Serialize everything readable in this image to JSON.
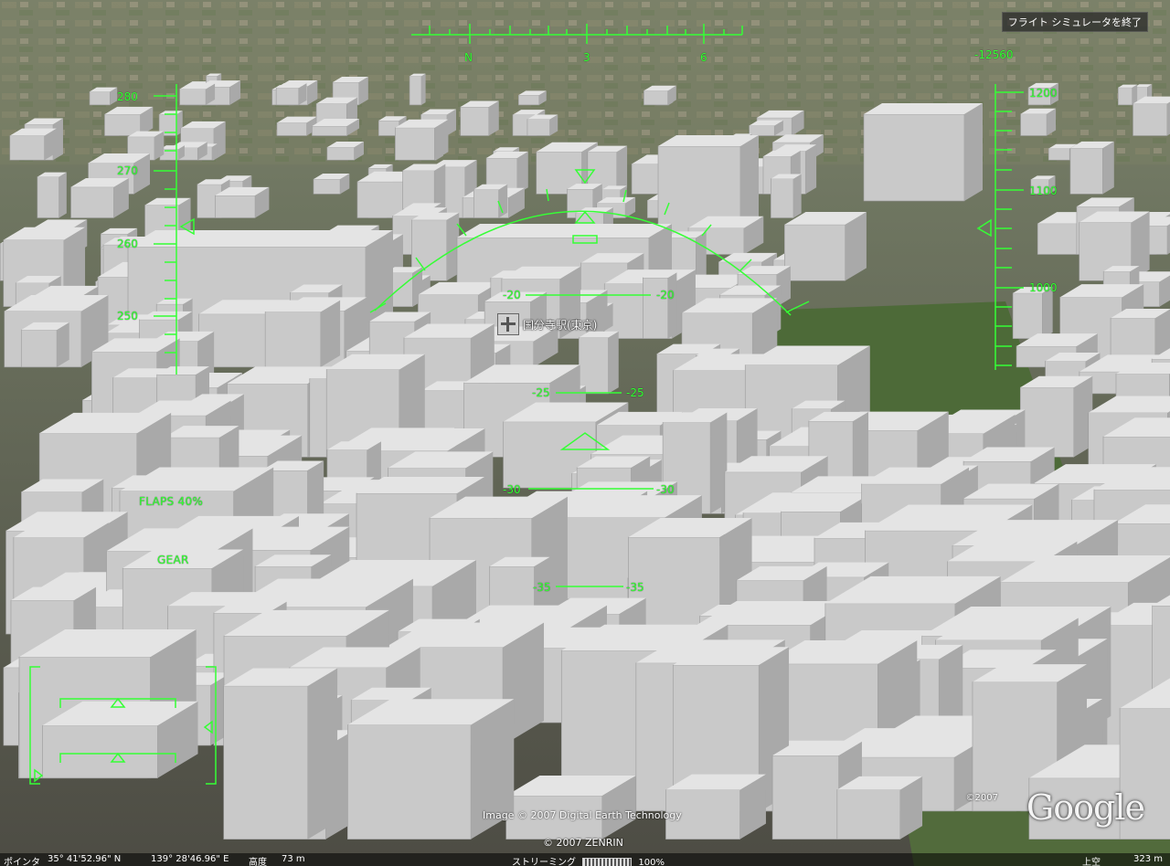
{
  "window": {
    "exit_button": "フライト シミュレータを終了"
  },
  "hud": {
    "heading_labels": [
      "N",
      "3",
      "6"
    ],
    "vertical_speed": "-12560",
    "speed_labels": [
      "280",
      "270",
      "260",
      "250"
    ],
    "altitude_labels": [
      "1200",
      "1100",
      "1000"
    ],
    "pitch_ladder": [
      {
        "left": "-20",
        "right": "-20"
      },
      {
        "left": "-25",
        "right": "-25"
      },
      {
        "left": "-30",
        "right": "-30"
      },
      {
        "left": "-35",
        "right": "-35"
      }
    ],
    "flaps": "FLAPS 40%",
    "gear": "GEAR",
    "color": "#35ff35"
  },
  "place_label": "国分寺駅(東京)",
  "credits": {
    "imagery": "Image © 2007 Digital Earth Technology",
    "zenrin": "© 2007 ZENRIN",
    "google_copy": "©2007",
    "google": "Google"
  },
  "status": {
    "pointer_label": "ポインタ",
    "lat": "35° 41'52.96\" N",
    "lon": "139° 28'46.96\" E",
    "altitude_label": "高度",
    "altitude_value": "73 m",
    "streaming_label": "ストリーミング",
    "streaming_percent": "100%",
    "sky_label": "上空",
    "sky_value": "323 m"
  }
}
